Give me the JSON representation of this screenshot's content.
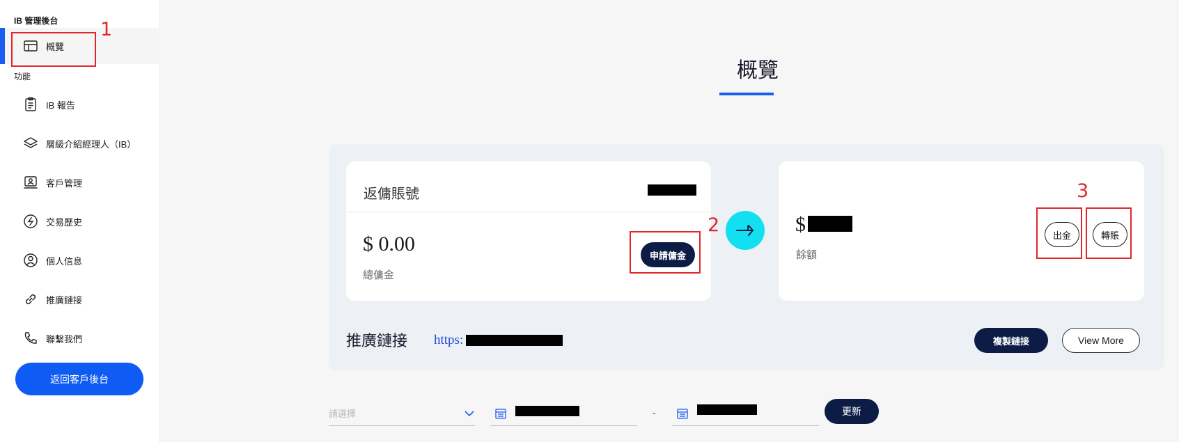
{
  "sidebar": {
    "section_ib": "IB 管理後台",
    "overview_label": "概覽",
    "section_functions": "功能",
    "items": [
      {
        "label": "IB 報告",
        "icon": "clipboard-icon"
      },
      {
        "label": "層級介紹經理人（IB）",
        "icon": "layers-icon"
      },
      {
        "label": "客戶管理",
        "icon": "monitor-icon"
      },
      {
        "label": "交易歷史",
        "icon": "lightning-circle-icon"
      },
      {
        "label": "個人信息",
        "icon": "user-circle-icon"
      },
      {
        "label": "推廣鏈接",
        "icon": "link-icon"
      },
      {
        "label": "聯繫我們",
        "icon": "phone-icon"
      }
    ],
    "back_button": "返回客戶後台"
  },
  "annotations": [
    "1",
    "2",
    "3"
  ],
  "main": {
    "title": "概覽",
    "rebate_card": {
      "title": "返傭賬號",
      "amount": "$ 0.00",
      "caption": "總傭金",
      "apply_button": "申請傭金"
    },
    "balance_card": {
      "currency": "$",
      "caption": "餘額",
      "withdraw_button": "出金",
      "transfer_button": "轉賬"
    },
    "promo": {
      "title": "推廣鏈接",
      "link_prefix": "https:",
      "copy_button": "複製鏈接",
      "view_more_button": "View More"
    },
    "filter": {
      "select_placeholder": "請選擇",
      "separator": "-",
      "update_button": "更新"
    }
  },
  "colors": {
    "accent": "#1d5cf0",
    "navy": "#0c1c44",
    "cyan": "#12e0f0",
    "annotation": "#e0262a"
  }
}
